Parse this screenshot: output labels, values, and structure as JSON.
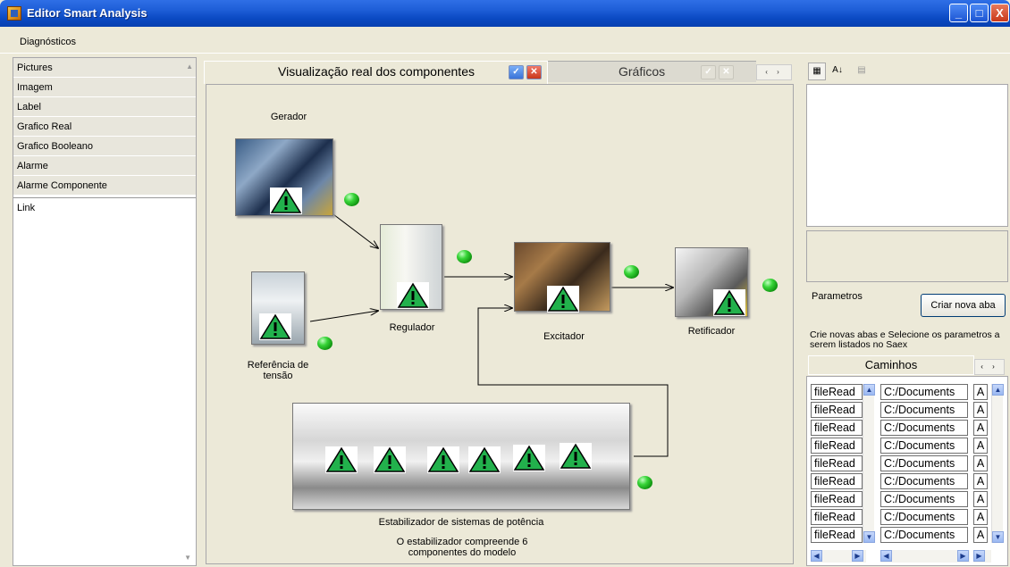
{
  "window": {
    "title": "Editor Smart Analysis",
    "controls": {
      "minimize": "_",
      "maximize": "□",
      "close": "X"
    }
  },
  "menu": {
    "items": [
      "Diagnósticos"
    ]
  },
  "toolbox": {
    "items": [
      "Pictures",
      "Imagem",
      "Label",
      "Grafico Real",
      "Grafico Booleano",
      "Alarme",
      "Alarme Componente",
      "Link"
    ]
  },
  "tabs": {
    "visual": "Visualização real dos componentes",
    "graphs": "Gráficos",
    "nav": "‹ ›",
    "check": "✓",
    "close": "✕"
  },
  "diagram": {
    "gerador": "Gerador",
    "referencia": "Referência de tensão",
    "regulador": "Regulador",
    "excitador": "Excitador",
    "retificador": "Retificador",
    "estabilizador": "Estabilizador de sistemas de potência",
    "estabilizador_note": "O estabilizador compreende 6 componentes do modelo"
  },
  "right_panel": {
    "param_label": "Parametros",
    "new_tab_button": "Criar nova aba",
    "hint": "Crie novas abas e Selecione os parametros a serem listados no Saex",
    "paths_tab": "Caminhos",
    "paths_nav": "‹ ›",
    "rows": [
      {
        "name": "fileRead",
        "path": "C:/Documents",
        "btn": "A"
      },
      {
        "name": "fileRead",
        "path": "C:/Documents",
        "btn": "A"
      },
      {
        "name": "fileRead",
        "path": "C:/Documents",
        "btn": "A"
      },
      {
        "name": "fileRead",
        "path": "C:/Documents",
        "btn": "A"
      },
      {
        "name": "fileRead",
        "path": "C:/Documents",
        "btn": "A"
      },
      {
        "name": "fileRead",
        "path": "C:/Documents",
        "btn": "A"
      },
      {
        "name": "fileRead",
        "path": "C:/Documents",
        "btn": "A"
      },
      {
        "name": "fileRead",
        "path": "C:/Documents",
        "btn": "A"
      },
      {
        "name": "fileRead",
        "path": "C:/Documents",
        "btn": "A"
      }
    ]
  },
  "colors": {
    "titlebar": "#0a49c2",
    "led": "#22c022",
    "warning": "#22b14c"
  }
}
